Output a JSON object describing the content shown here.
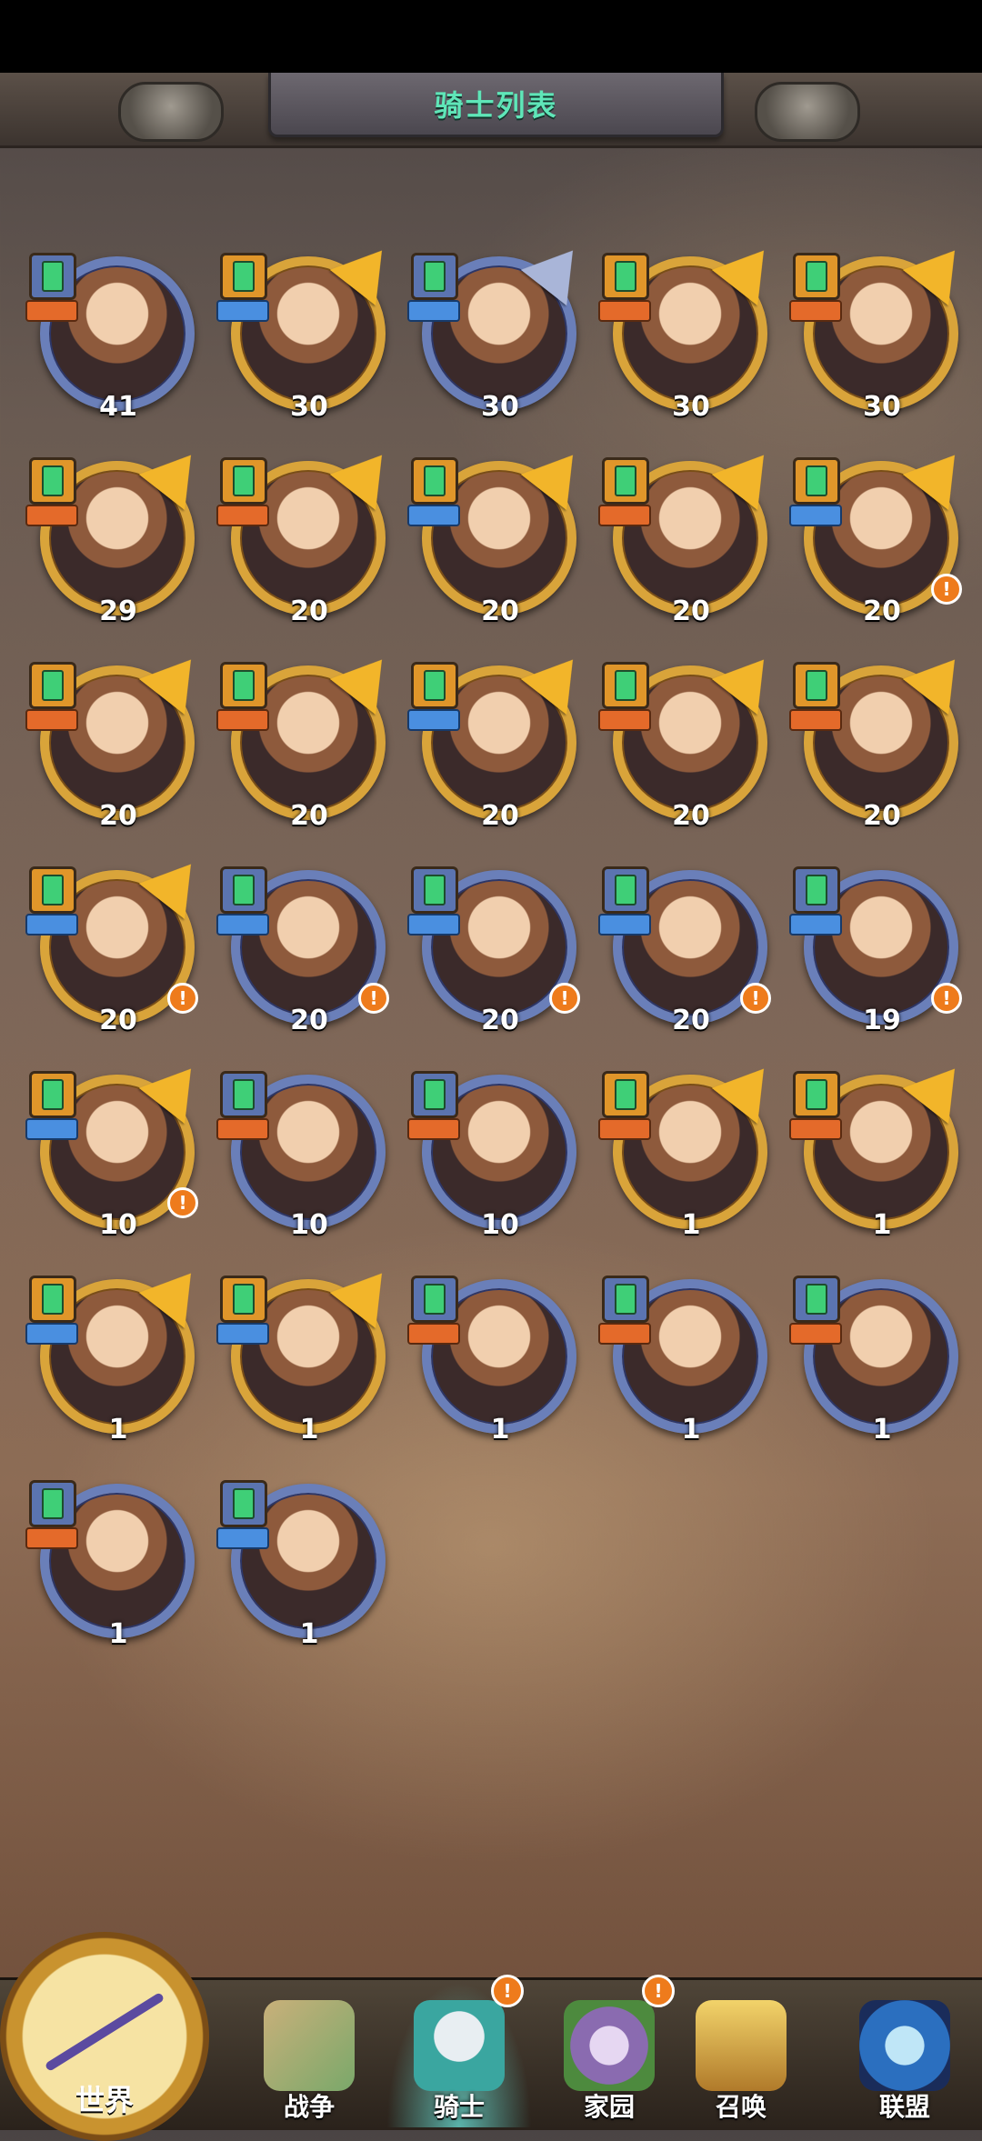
{
  "header": {
    "title": "骑士列表"
  },
  "knights": [
    {
      "level": "41",
      "frame": "blue",
      "role": "orange",
      "alert": false,
      "tri": false
    },
    {
      "level": "30",
      "frame": "gold",
      "role": "blue",
      "alert": false,
      "tri": true
    },
    {
      "level": "30",
      "frame": "blue",
      "role": "blue",
      "alert": false,
      "tri": true
    },
    {
      "level": "30",
      "frame": "gold",
      "role": "orange",
      "alert": false,
      "tri": true
    },
    {
      "level": "30",
      "frame": "gold",
      "role": "orange",
      "alert": false,
      "tri": true
    },
    {
      "level": "29",
      "frame": "gold",
      "role": "orange",
      "alert": false,
      "tri": true
    },
    {
      "level": "20",
      "frame": "gold",
      "role": "orange",
      "alert": false,
      "tri": true
    },
    {
      "level": "20",
      "frame": "gold",
      "role": "blue",
      "alert": false,
      "tri": true
    },
    {
      "level": "20",
      "frame": "gold",
      "role": "orange",
      "alert": false,
      "tri": true
    },
    {
      "level": "20",
      "frame": "gold",
      "role": "blue",
      "alert": true,
      "tri": true
    },
    {
      "level": "20",
      "frame": "gold",
      "role": "orange",
      "alert": false,
      "tri": true
    },
    {
      "level": "20",
      "frame": "gold",
      "role": "orange",
      "alert": false,
      "tri": true
    },
    {
      "level": "20",
      "frame": "gold",
      "role": "blue",
      "alert": false,
      "tri": true
    },
    {
      "level": "20",
      "frame": "gold",
      "role": "orange",
      "alert": false,
      "tri": true
    },
    {
      "level": "20",
      "frame": "gold",
      "role": "orange",
      "alert": false,
      "tri": true
    },
    {
      "level": "20",
      "frame": "gold",
      "role": "blue",
      "alert": true,
      "tri": true
    },
    {
      "level": "20",
      "frame": "blue",
      "role": "blue",
      "alert": true,
      "tri": false
    },
    {
      "level": "20",
      "frame": "blue",
      "role": "blue",
      "alert": true,
      "tri": false
    },
    {
      "level": "20",
      "frame": "blue",
      "role": "blue",
      "alert": true,
      "tri": false
    },
    {
      "level": "19",
      "frame": "blue",
      "role": "blue",
      "alert": true,
      "tri": false
    },
    {
      "level": "10",
      "frame": "gold",
      "role": "blue",
      "alert": true,
      "tri": true
    },
    {
      "level": "10",
      "frame": "blue",
      "role": "orange",
      "alert": false,
      "tri": false
    },
    {
      "level": "10",
      "frame": "blue",
      "role": "orange",
      "alert": false,
      "tri": false
    },
    {
      "level": "1",
      "frame": "gold",
      "role": "orange",
      "alert": false,
      "tri": true
    },
    {
      "level": "1",
      "frame": "gold",
      "role": "orange",
      "alert": false,
      "tri": true
    },
    {
      "level": "1",
      "frame": "gold",
      "role": "blue",
      "alert": false,
      "tri": true
    },
    {
      "level": "1",
      "frame": "gold",
      "role": "blue",
      "alert": false,
      "tri": true
    },
    {
      "level": "1",
      "frame": "blue",
      "role": "orange",
      "alert": false,
      "tri": false
    },
    {
      "level": "1",
      "frame": "blue",
      "role": "orange",
      "alert": false,
      "tri": false
    },
    {
      "level": "1",
      "frame": "blue",
      "role": "orange",
      "alert": false,
      "tri": false
    },
    {
      "level": "1",
      "frame": "blue",
      "role": "orange",
      "alert": false,
      "tri": false
    },
    {
      "level": "1",
      "frame": "blue",
      "role": "blue",
      "alert": false,
      "tri": false
    }
  ],
  "alert_mark": "!",
  "nav": {
    "world": "世界",
    "war": "战争",
    "knight": "骑士",
    "home": "家园",
    "summon": "召唤",
    "alliance": "联盟"
  },
  "colors": {
    "accent_title": "#5fe6b8",
    "gold_frame": "#d9a43a",
    "blue_frame": "#6a7fb9",
    "alert": "#ee7b1c"
  }
}
